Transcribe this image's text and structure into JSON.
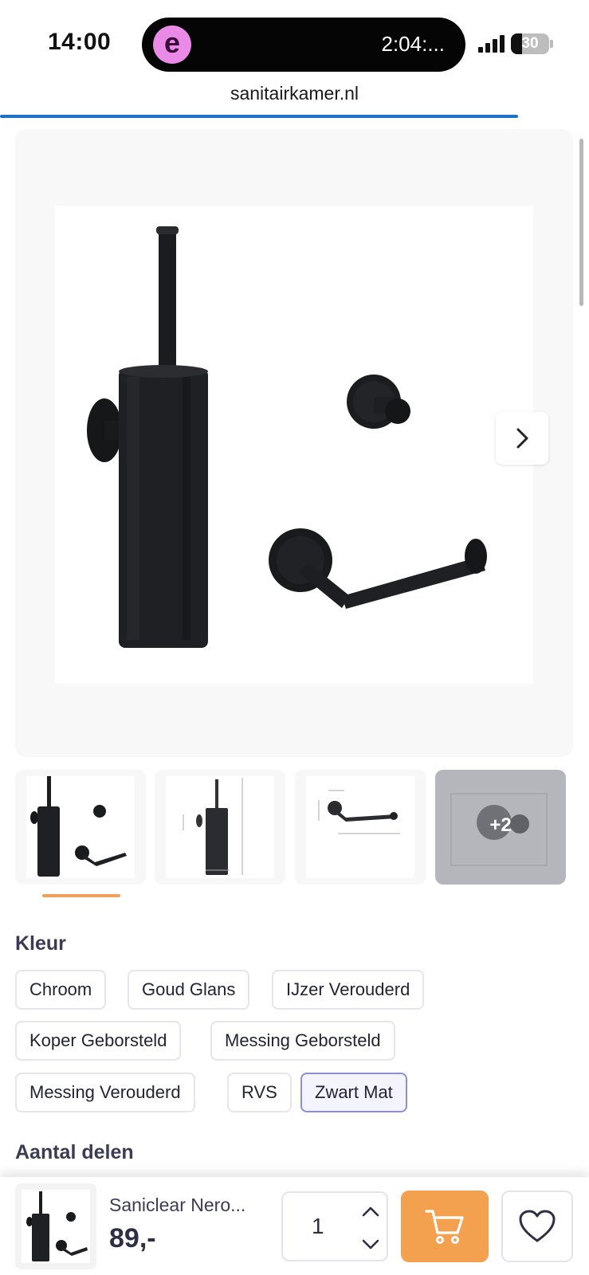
{
  "status_bar": {
    "time": "14:00",
    "island_app_letter": "e",
    "island_timer": "2:04:...",
    "battery_level": "30",
    "signal_icon": "cellular-signal-icon",
    "battery_icon": "battery-icon"
  },
  "browser": {
    "url": "sanitairkamer.nl",
    "load_progress": 0.88
  },
  "gallery": {
    "next_icon": "chevron-right-icon",
    "thumbnails_more_label": "+2",
    "active_thumbnail": 1
  },
  "options": {
    "color_title": "Kleur",
    "colors": [
      "Chroom",
      "Goud Glans",
      "IJzer Verouderd",
      "Koper Geborsteld",
      "Messing Geborsteld",
      "Messing Verouderd",
      "RVS",
      "Zwart Mat"
    ],
    "selected_color": "Zwart Mat",
    "parts_title": "Aantal delen"
  },
  "sticky_bar": {
    "product_name": "Saniclear Nero...",
    "price": "89,-",
    "quantity": "1",
    "cart_icon": "shopping-cart-icon",
    "wishlist_icon": "heart-icon"
  },
  "colors": {
    "accent": "#f4a14f",
    "progress": "#1a73c9",
    "selected_border": "#8c8fd4"
  }
}
